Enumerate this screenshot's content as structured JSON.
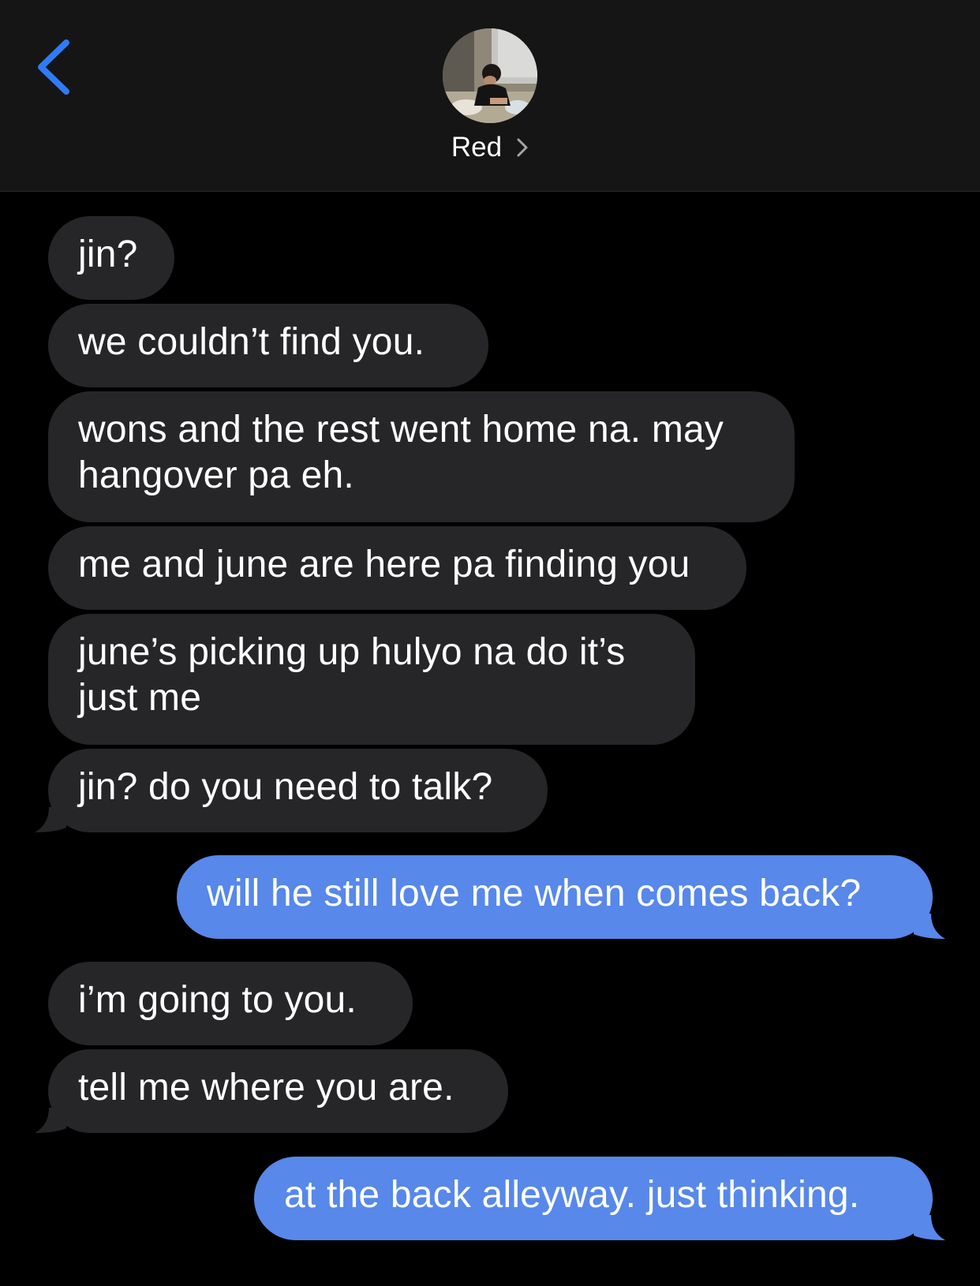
{
  "header": {
    "back_icon": "chevron-left-icon",
    "contact_name": "Red",
    "avatar_icon": "contact-photo",
    "chevron_icon": "chevron-right-icon",
    "accent_color": "#2f7bf5"
  },
  "messages": [
    {
      "direction": "incoming",
      "text": "jin?"
    },
    {
      "direction": "incoming",
      "text": "we couldn’t find you."
    },
    {
      "direction": "incoming",
      "text": "wons and the rest went home na. may hangover pa eh."
    },
    {
      "direction": "incoming",
      "text": "me and june are here pa finding you"
    },
    {
      "direction": "incoming",
      "text": "june’s picking up hulyo na do it’s just me"
    },
    {
      "direction": "incoming",
      "text": "jin? do you need to talk?"
    },
    {
      "direction": "outgoing",
      "text": "will he still love me when comes back?"
    },
    {
      "direction": "incoming",
      "text": "i’m going to you."
    },
    {
      "direction": "incoming",
      "text": "tell me where you are."
    },
    {
      "direction": "outgoing",
      "text": "at the back alleyway. just thinking."
    }
  ],
  "colors": {
    "incoming_bubble": "#262629",
    "outgoing_bubble": "#5788ea",
    "background": "#000000",
    "header_background": "#151515"
  }
}
